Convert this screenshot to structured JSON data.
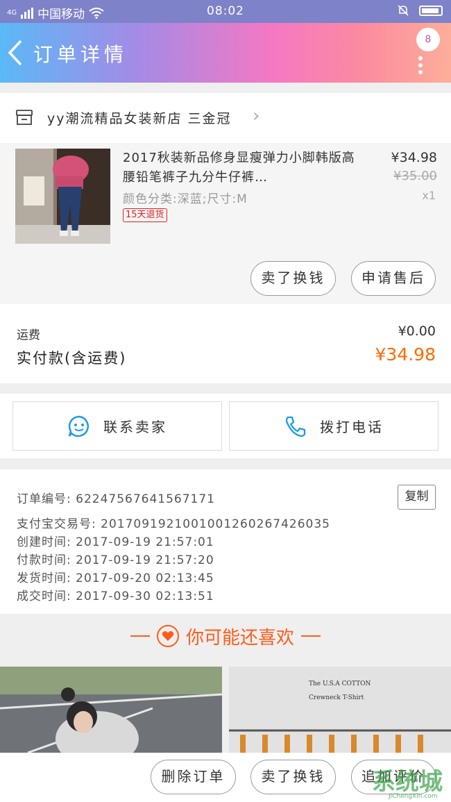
{
  "status_bar": {
    "signal": "4G",
    "carrier": "中国移动",
    "time": "08:02"
  },
  "header": {
    "title": "订单详情",
    "message_count": "8"
  },
  "shop": {
    "name": "yy潮流精品女装新店 三金冠"
  },
  "item": {
    "title": "2017秋装新品修身显瘦弹力小脚韩版高腰铅笔裤子九分牛仔裤…",
    "sku": "颜色分类:深蓝;尺寸:M",
    "return_tag": "15天退货",
    "price": "¥34.98",
    "original_price": "¥35.00",
    "quantity": "x1",
    "buttons": [
      "卖了换钱",
      "申请售后"
    ]
  },
  "fees": {
    "shipping_label": "运费",
    "shipping_value": "¥0.00",
    "paid_label": "实付款(含运费)",
    "paid_value": "¥34.98"
  },
  "contact": {
    "seller_label": "联系卖家",
    "phone_label": "拨打电话"
  },
  "order_info": {
    "order_no": "订单编号: 62247567641567171",
    "copy_label": "复制",
    "alipay_no": "支付宝交易号: 2017091921001001260267426035",
    "created": "创建时间: 2017-09-19 21:57:01",
    "paid": "付款时间: 2017-09-19 21:57:20",
    "shipped": "发货时间: 2017-09-20 02:13:45",
    "completed": "成交时间: 2017-09-30 02:13:51"
  },
  "recommend": {
    "title": "你可能还喜欢",
    "right_photo_text": [
      "The U.S.A COTTON",
      "Crewneck T-Shirt"
    ]
  },
  "bottom_bar": {
    "buttons": [
      "删除订单",
      "卖了换钱",
      "追加评价"
    ]
  },
  "watermark": {
    "logo": "系统城",
    "url": "JiChengXin.com"
  },
  "colors": {
    "accent_orange": "#ff6a00",
    "return_tag_red": "#e02020",
    "chat_blue": "#1f9be9"
  }
}
